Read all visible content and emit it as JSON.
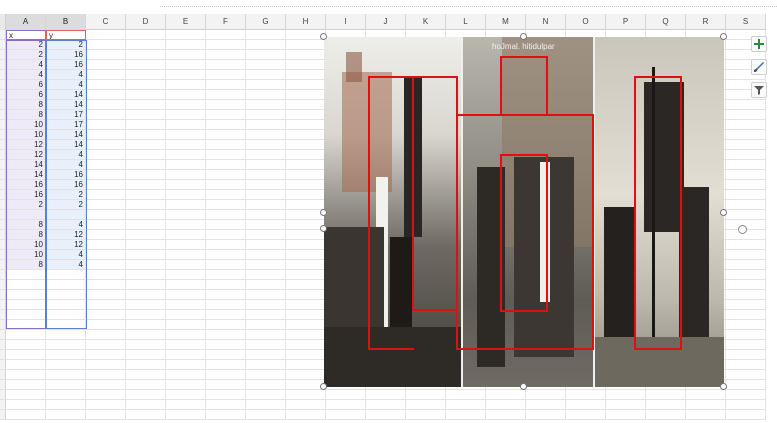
{
  "columns": [
    "A",
    "B",
    "C",
    "D",
    "E",
    "F",
    "G",
    "H",
    "I",
    "J",
    "K",
    "L",
    "M",
    "N",
    "O",
    "P",
    "Q",
    "R",
    "S"
  ],
  "headers": {
    "x": "x",
    "y": "y"
  },
  "rows": [
    [
      "2",
      "2"
    ],
    [
      "2",
      "16"
    ],
    [
      "4",
      "16"
    ],
    [
      "4",
      "4"
    ],
    [
      "6",
      "4"
    ],
    [
      "6",
      "14"
    ],
    [
      "8",
      "14"
    ],
    [
      "8",
      "17"
    ],
    [
      "10",
      "17"
    ],
    [
      "10",
      "14"
    ],
    [
      "12",
      "14"
    ],
    [
      "12",
      "4"
    ],
    [
      "14",
      "4"
    ],
    [
      "14",
      "16"
    ],
    [
      "16",
      "16"
    ],
    [
      "16",
      "2"
    ],
    [
      "2",
      "2"
    ],
    [
      "",
      ""
    ],
    [
      "8",
      "4"
    ],
    [
      "8",
      "12"
    ],
    [
      "10",
      "12"
    ],
    [
      "10",
      "4"
    ],
    [
      "8",
      "4"
    ]
  ],
  "image": {
    "watermark": "hoJmal.  hitidulpar"
  },
  "side_buttons": {
    "add": {
      "icon": "plus-icon",
      "color": "#2e8b3e"
    },
    "style": {
      "icon": "brush-icon",
      "color": "#2f6fb5"
    },
    "filter": {
      "icon": "filter-icon",
      "color": "#555555"
    }
  },
  "colors": {
    "highlight": "#e01010",
    "col_a_fill": "#efeaf7",
    "col_b_fill": "#e7f0fb"
  }
}
